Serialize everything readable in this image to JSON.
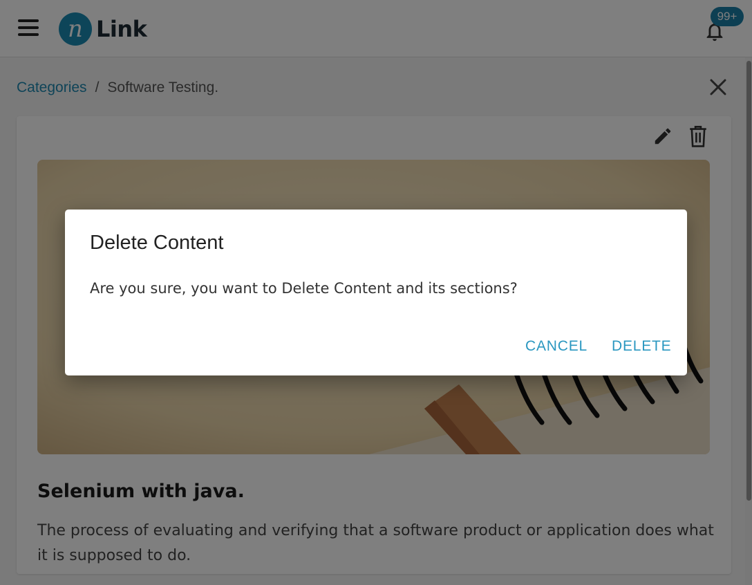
{
  "header": {
    "logo_mark": "n",
    "logo_text": "Link",
    "notification_badge": "99+"
  },
  "breadcrumb": {
    "root": "Categories",
    "separator": "/",
    "current": "Software Testing."
  },
  "content": {
    "title": "Selenium with java.",
    "description": "The process of evaluating and verifying that a software product or application does what it is supposed to do."
  },
  "dialog": {
    "title": "Delete Content",
    "message": "Are you sure, you want to Delete Content and its sections?",
    "cancel_label": "CANCEL",
    "delete_label": "DELETE"
  },
  "icons": {
    "menu": "hamburger-menu-icon",
    "notifications": "bell-icon",
    "close": "close-icon",
    "edit": "pencil-icon",
    "delete": "trash-icon"
  },
  "colors": {
    "brand": "#1a8bb3",
    "link": "#1f88b0",
    "dialog_action": "#2a97c0"
  }
}
